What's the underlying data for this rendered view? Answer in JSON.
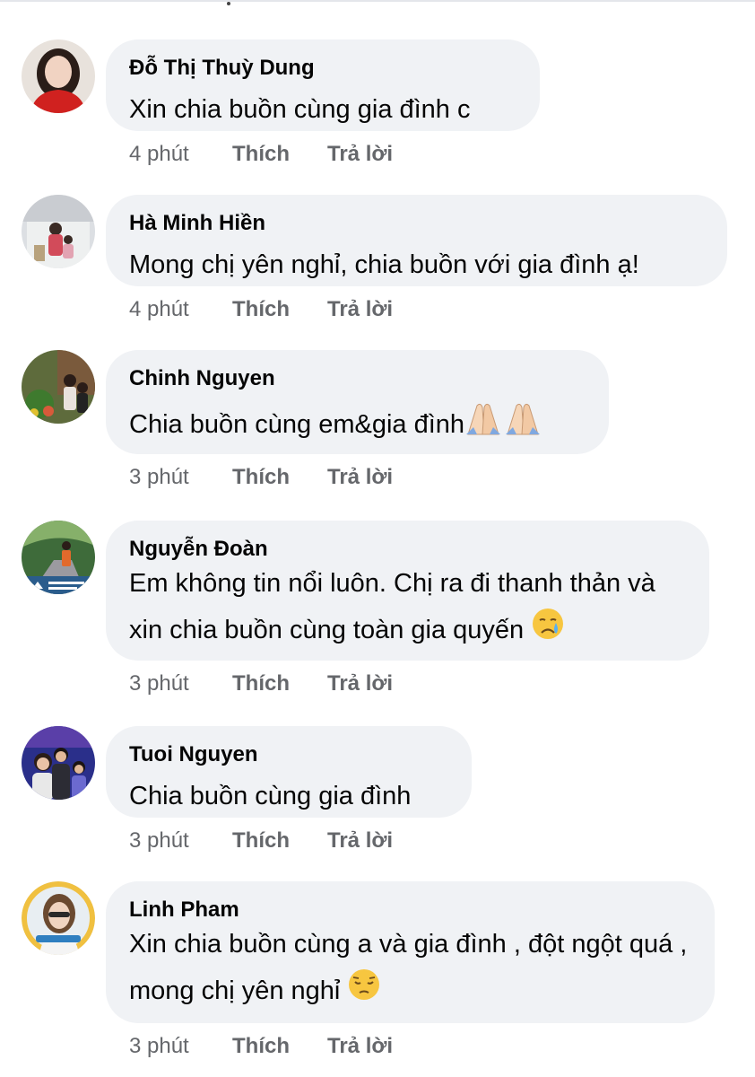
{
  "comments": [
    {
      "name": "Đỗ Thị Thuỳ Dung",
      "text": "Xin chia buồn cùng gia đình c",
      "time": "4 phút",
      "like": "Thích",
      "reply": "Trả lời"
    },
    {
      "name": "Hà Minh Hiền",
      "text": "Mong chị yên nghỉ, chia buồn với gia đình ạ!",
      "time": "4 phút",
      "like": "Thích",
      "reply": "Trả lời"
    },
    {
      "name": "Chinh Nguyen",
      "text": "Chia buồn cùng em&gia đình",
      "emoji": "folded-hands-icon",
      "time": "3 phút",
      "like": "Thích",
      "reply": "Trả lời"
    },
    {
      "name": "Nguyễn Đoàn",
      "text": "Em không tin nổi luôn. Chị ra đi thanh thản và xin chia buồn cùng toàn gia quyến",
      "emoji": "crying-face-icon",
      "time": "3 phút",
      "like": "Thích",
      "reply": "Trả lời"
    },
    {
      "name": "Tuoi Nguyen",
      "text": "Chia buồn cùng gia đình",
      "time": "3 phút",
      "like": "Thích",
      "reply": "Trả lời"
    },
    {
      "name": "Linh Pham",
      "text": "Xin chia buồn cùng a và gia đình , đột ngột quá , mong chị yên nghỉ",
      "emoji": "pensive-face-icon",
      "time": "3 phút",
      "like": "Thích",
      "reply": "Trả lời"
    }
  ],
  "colors": {
    "bubble": "#f0f2f5",
    "meta": "#65676b",
    "text": "#050505"
  }
}
